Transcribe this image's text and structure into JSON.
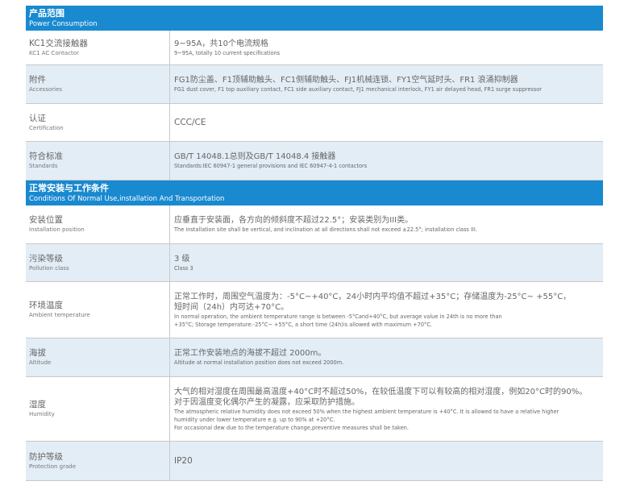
{
  "sections": [
    {
      "title_zh": "产品范围",
      "title_en": "Power Consumption",
      "rows": [
        {
          "label_zh": "KC1交流接触器",
          "label_en": "KC1 AC Contactor",
          "value_zh": [
            "9~95A，共10个电流规格"
          ],
          "value_en": [
            "9~95A, totally 10 current specifications"
          ]
        },
        {
          "label_zh": "附件",
          "label_en": "Accessories",
          "value_zh": [
            "FG1防尘盖、F1顶辅助触头、FC1侧辅助触头、FJ1机械连锁、FY1空气延时头、FR1 浪涌抑制器"
          ],
          "value_en": [
            "FG1 dust cover, F1 top auxiliary contact, FC1 side auxiliary contact, FJ1 mechanical interlock, FY1 air delayed head, FR1 surge suppressor"
          ]
        },
        {
          "label_zh": "认证",
          "label_en": "Certification",
          "value_zh": [
            "CCC/CE"
          ],
          "value_en": []
        },
        {
          "label_zh": "符合标准",
          "label_en": "Standards",
          "value_zh": [
            "GB/T 14048.1总则及GB/T 14048.4 接触器"
          ],
          "value_en": [
            "Standards:IEC 60947-1 general provisions and IEC 60947-4-1 contactors"
          ]
        }
      ]
    },
    {
      "title_zh": "正常安装与工作条件",
      "title_en": "Conditions Of Normal Use,installation And Transportation",
      "rows": [
        {
          "label_zh": "安装位置",
          "label_en": "Installation position",
          "value_zh": [
            "应垂直于安装面，各方向的倾斜度不超过22.5°；安装类别为III类。"
          ],
          "value_en": [
            "The installation site shall be vertical, and inclination at all directions shall not exceed ±22.5°; installation class III."
          ]
        },
        {
          "label_zh": "污染等级",
          "label_en": "Pollution class",
          "value_zh": [
            "3 级"
          ],
          "value_en": [
            "Class 3"
          ]
        },
        {
          "label_zh": "环境温度",
          "label_en": "Ambient temperature",
          "value_zh": [
            "正常工作时，周围空气温度为：-5°C~+40°C，24小时内平均值不超过+35°C；存储温度为-25°C~ +55°C，",
            "短时间（24h）内可达+70°C。"
          ],
          "value_en": [
            "In normal operation, the ambient temperature range is between -5°Cand+40°C, but average value in 24th is no more than",
            "+35°C; Storage temperature:-25°C~ +55°C, a short time (24h)is allowed with maximum +70°C."
          ]
        },
        {
          "label_zh": "海拔",
          "label_en": "Altitude",
          "value_zh": [
            "正常工作安装地点的海拔不超过 2000m。"
          ],
          "value_en": [
            "Altitude at normal installation position does not exceed 2000m."
          ]
        },
        {
          "label_zh": "湿度",
          "label_en": "Humidity",
          "value_zh": [
            "大气的相对湿度在周围最高温度+40°C时不超过50%，在较低温度下可以有较高的相对湿度，例如20°C时的90%。",
            "对于因温度变化偶尔产生的凝露，应采取防护措施。"
          ],
          "value_en": [
            "The atmospheric relative humidity does not exceed 50% when the highest ambient temperature is +40°C. It is allowed to have a relative higher",
            "humidity under lower temperature e.g. up to 90% at +20°C.",
            "For occasional dew due to the temperature change,preventive measures shall be taken."
          ]
        },
        {
          "label_zh": "防护等级",
          "label_en": "Protection grade",
          "value_zh": [
            "IP20"
          ],
          "value_en": []
        }
      ]
    }
  ]
}
